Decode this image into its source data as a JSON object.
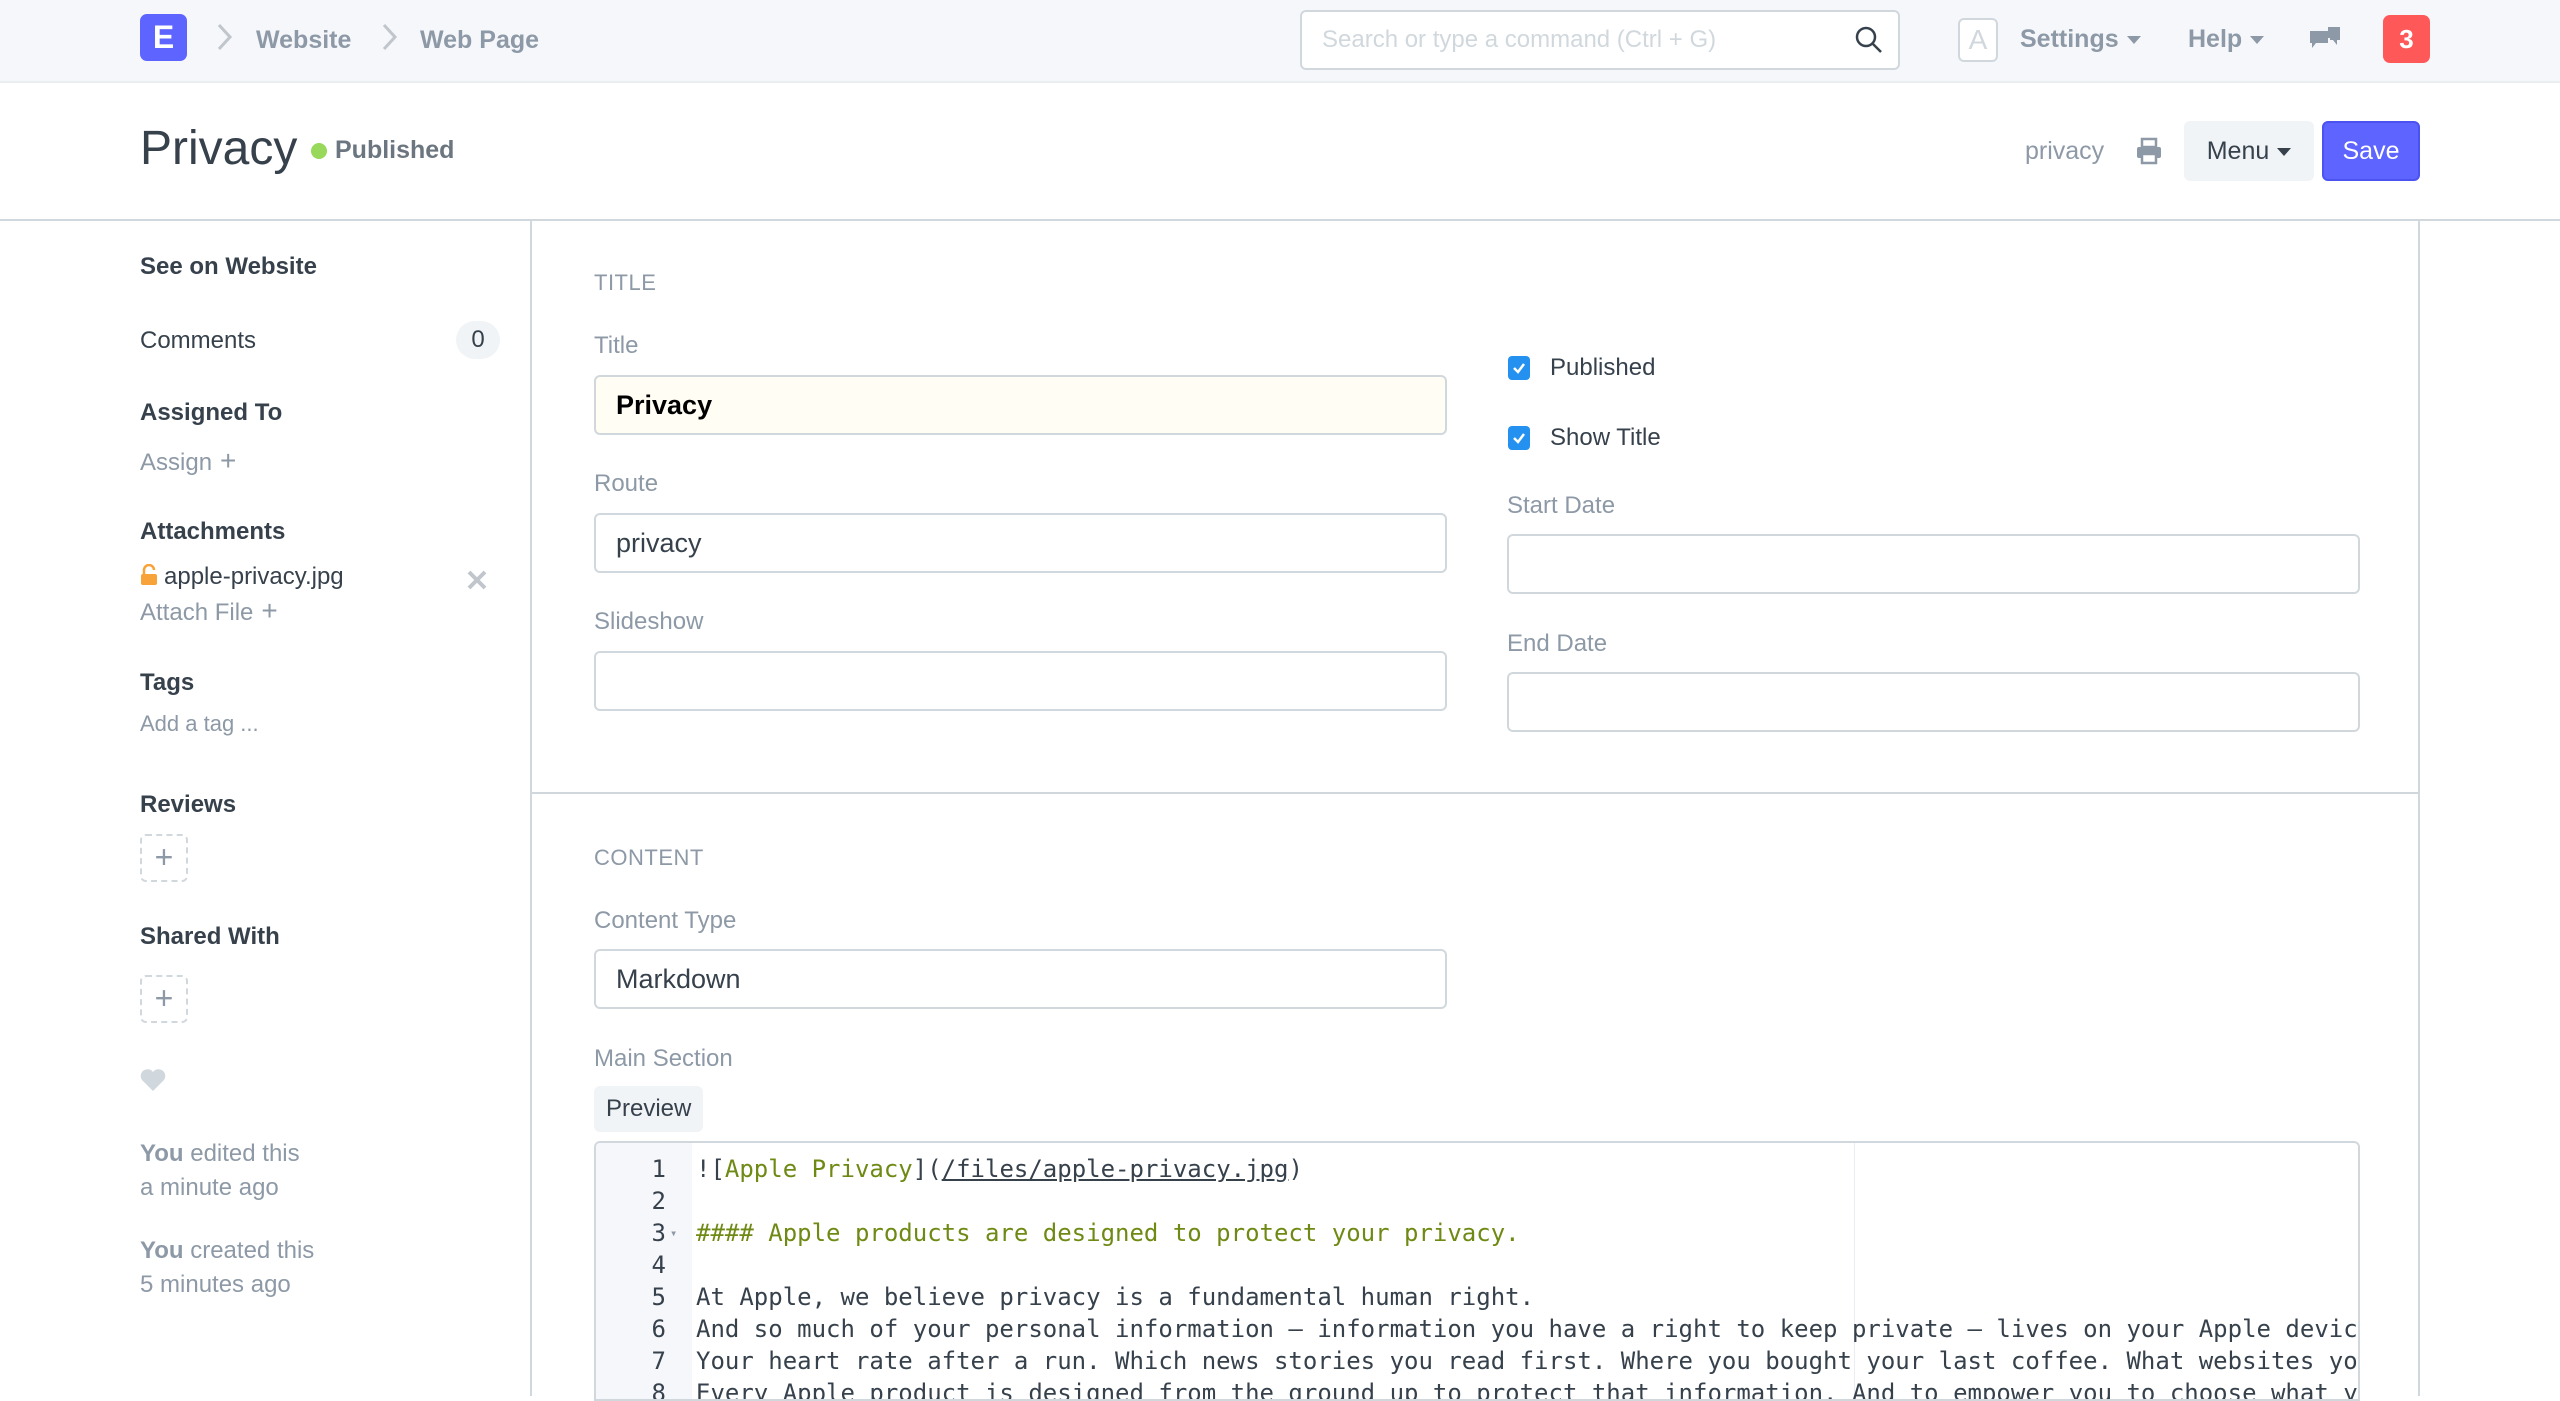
{
  "navbar": {
    "logo_letter": "E",
    "breadcrumbs": [
      "Website",
      "Web Page"
    ],
    "search_placeholder": "Search or type a command (Ctrl + G)",
    "avatar_letter": "A",
    "settings_label": "Settings",
    "help_label": "Help",
    "notification_count": "3"
  },
  "page_head": {
    "title": "Privacy",
    "status": "Published",
    "status_color": "#98d85b",
    "route": "privacy",
    "menu_label": "Menu",
    "save_label": "Save"
  },
  "sidebar": {
    "see_on_website": "See on Website",
    "comments_label": "Comments",
    "comments_count": "0",
    "assigned_to_label": "Assigned To",
    "assign_label": "Assign",
    "attachments_label": "Attachments",
    "attachment_file": "apple-privacy.jpg",
    "attach_file_label": "Attach File",
    "tags_label": "Tags",
    "add_tag_label": "Add a tag ...",
    "reviews_label": "Reviews",
    "shared_with_label": "Shared With",
    "timeline": [
      {
        "actor": "You",
        "action": "edited this",
        "when": "a minute ago"
      },
      {
        "actor": "You",
        "action": "created this",
        "when": "5 minutes ago"
      }
    ]
  },
  "form": {
    "title_section": {
      "heading": "TITLE",
      "title_label": "Title",
      "title_value": "Privacy",
      "route_label": "Route",
      "route_value": "privacy",
      "slideshow_label": "Slideshow",
      "slideshow_value": "",
      "published_label": "Published",
      "published_checked": true,
      "show_title_label": "Show Title",
      "show_title_checked": true,
      "start_date_label": "Start Date",
      "start_date_value": "",
      "end_date_label": "End Date",
      "end_date_value": ""
    },
    "content_section": {
      "heading": "CONTENT",
      "content_type_label": "Content Type",
      "content_type_value": "Markdown",
      "main_section_label": "Main Section",
      "preview_label": "Preview",
      "code_lines": [
        {
          "n": "1",
          "parts": [
            [
              "plain",
              "!["
            ],
            [
              "text",
              "Apple Privacy"
            ],
            [
              "plain",
              "]("
            ],
            [
              "link",
              "/files/apple-privacy.jpg"
            ],
            [
              "plain",
              ")"
            ]
          ]
        },
        {
          "n": "2",
          "parts": []
        },
        {
          "n": "3",
          "fold": true,
          "parts": [
            [
              "head",
              "#### Apple products are designed to protect your privacy."
            ]
          ]
        },
        {
          "n": "4",
          "parts": []
        },
        {
          "n": "5",
          "parts": [
            [
              "plain",
              "At Apple, we believe privacy is a fundamental human right."
            ]
          ]
        },
        {
          "n": "6",
          "parts": [
            [
              "plain",
              "And so much of your personal information — information you have a right to keep private — lives on your Apple devic"
            ]
          ]
        },
        {
          "n": "7",
          "parts": [
            [
              "plain",
              "Your heart rate after a run. Which news stories you read first. Where you bought your last coffee. What websites you"
            ]
          ]
        },
        {
          "n": "8",
          "parts": [
            [
              "plain",
              "Every Apple product is designed from the ground up to protect that information. And to empower you to choose what yo"
            ]
          ]
        }
      ]
    }
  }
}
